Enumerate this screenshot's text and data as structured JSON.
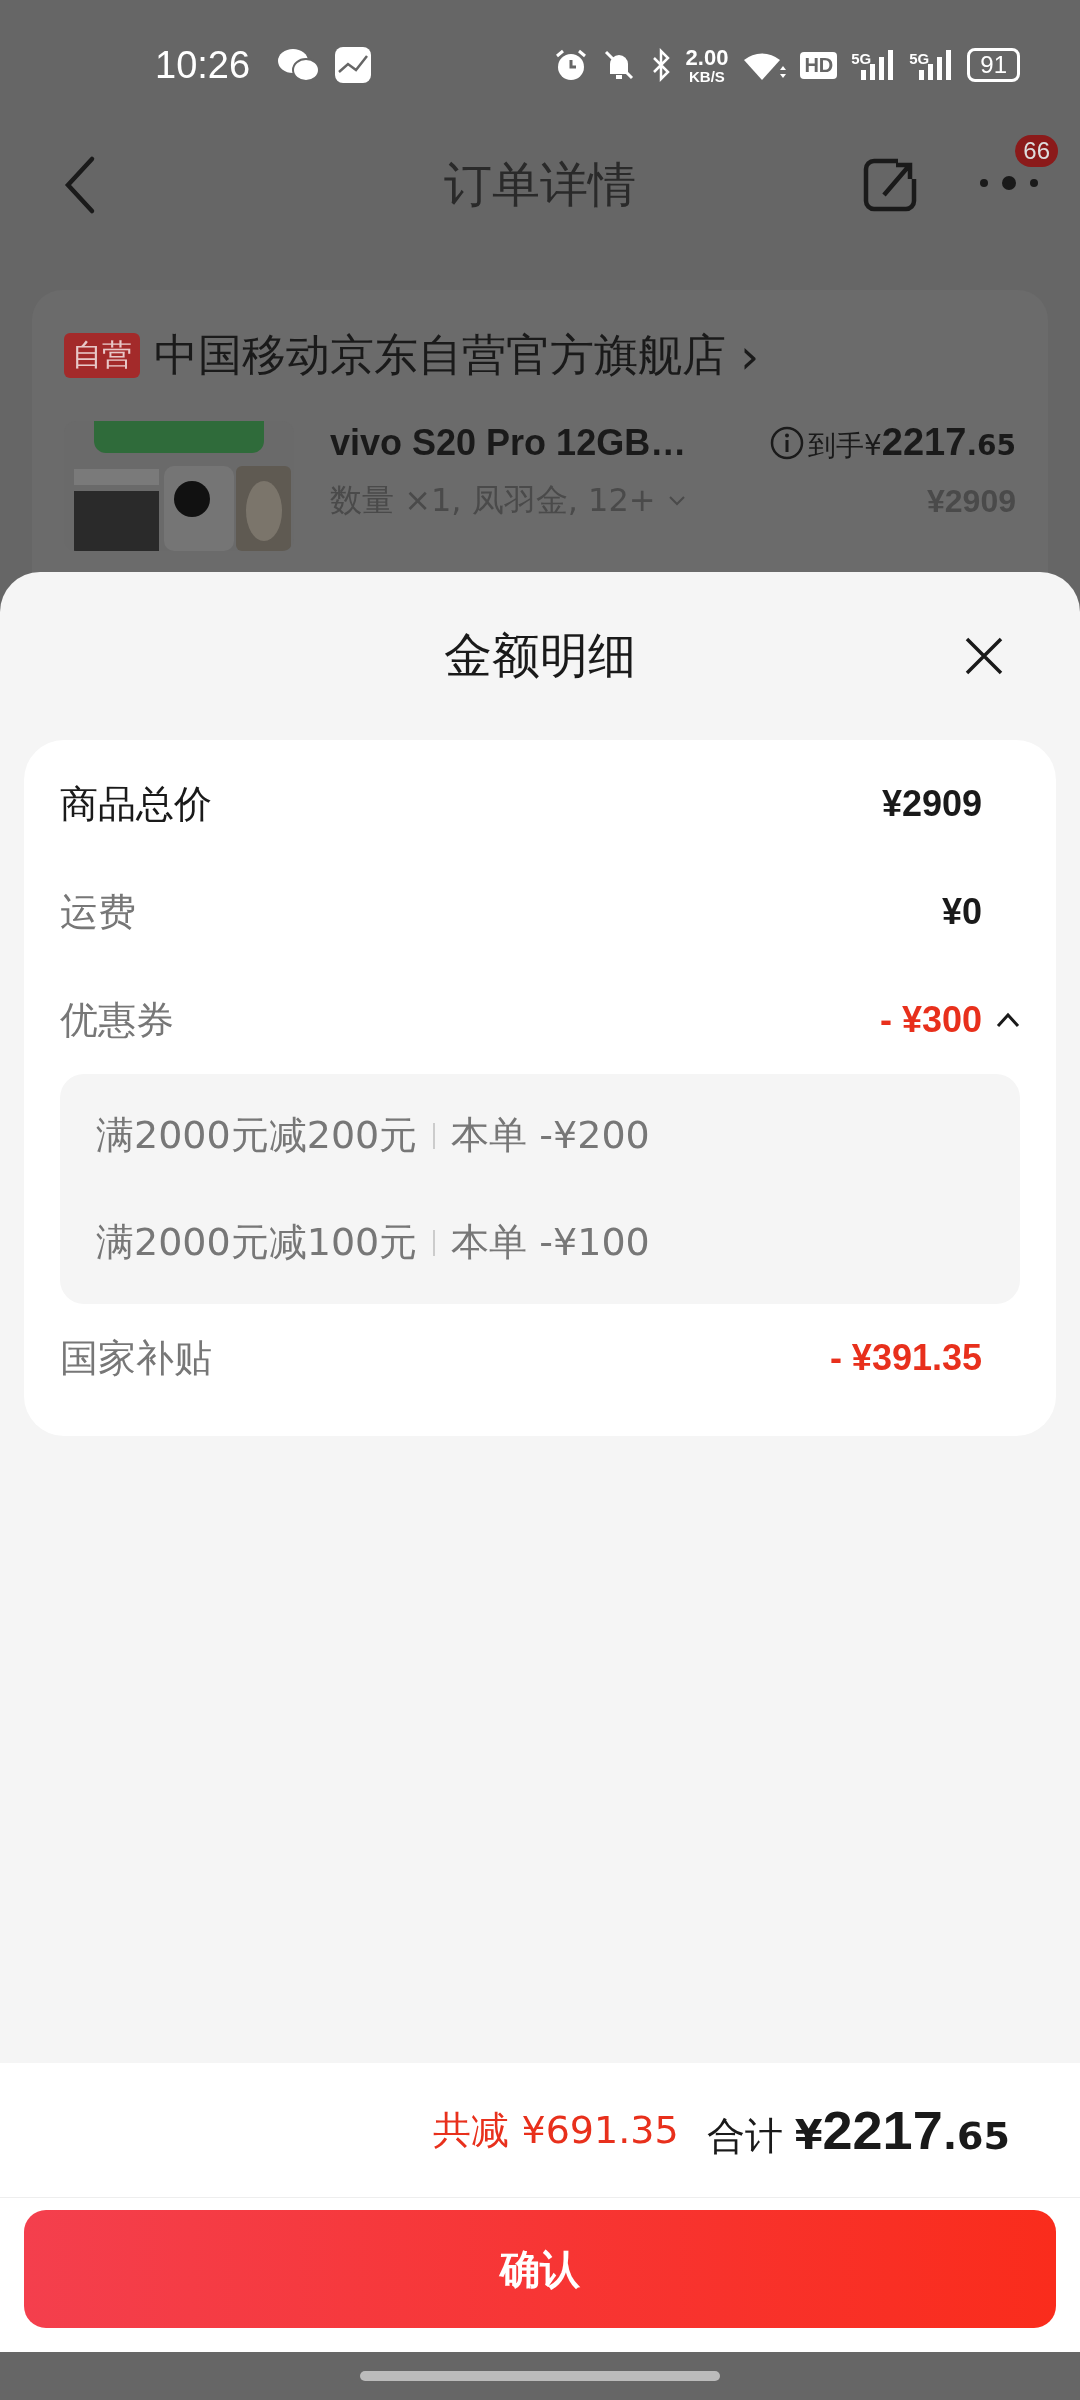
{
  "status_bar": {
    "time": "10:26",
    "net_speed": "2.00",
    "net_unit": "KB/S",
    "hd": "HD",
    "signals": [
      "5G",
      "5G"
    ],
    "battery": "91"
  },
  "header": {
    "title": "订单详情",
    "badge": "66"
  },
  "store": {
    "tag": "自营",
    "name": "中国移动京东自营官方旗舰店",
    "chevron": "›"
  },
  "product": {
    "name": "vivo S20 Pro 12GB…",
    "spec": "数量 ×1, 凤羽金, 12+",
    "final_label": "到手¥",
    "final_int": "2217",
    "final_dec": ".65",
    "original_price": "¥2909"
  },
  "sheet": {
    "title": "金额明细",
    "rows": [
      {
        "kind": "total",
        "label": "商品总价",
        "value": "¥2909"
      },
      {
        "kind": "plain",
        "label": "运费",
        "value": "¥0"
      },
      {
        "kind": "coupon",
        "label": "优惠券",
        "value": "- ¥300",
        "expanded": true,
        "coupons": [
          {
            "name": "满2000元减200元",
            "amount": "本单 -¥200"
          },
          {
            "name": "满2000元减100元",
            "amount": "本单 -¥100"
          }
        ]
      },
      {
        "kind": "discount",
        "label": "国家补贴",
        "value": "- ¥391.35"
      }
    ]
  },
  "footer": {
    "saved_label": "共减",
    "saved": "¥691.35",
    "total_label": "合计",
    "currency": "¥",
    "total_int": "2217",
    "total_dec": ".65",
    "confirm": "确认"
  }
}
